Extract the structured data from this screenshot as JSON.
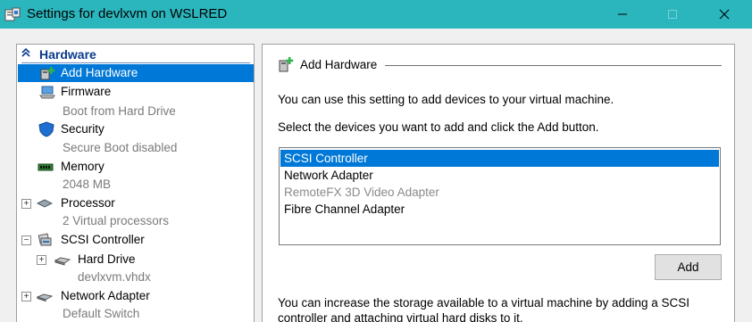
{
  "window": {
    "title": "Settings for devlxvm on WSLRED",
    "minimize_glyph": "—",
    "maximize_glyph": "☐",
    "close_glyph": "✕"
  },
  "tree": {
    "header": "Hardware",
    "header_glyph": "»",
    "items": [
      {
        "label": "Add Hardware",
        "sub": "",
        "icon": "add-hardware-icon",
        "selected": true
      },
      {
        "label": "Firmware",
        "sub": "Boot from Hard Drive",
        "icon": "firmware-icon"
      },
      {
        "label": "Security",
        "sub": "Secure Boot disabled",
        "icon": "shield-icon"
      },
      {
        "label": "Memory",
        "sub": "2048 MB",
        "icon": "memory-icon"
      },
      {
        "label": "Processor",
        "sub": "2 Virtual processors",
        "icon": "processor-icon",
        "expander": "+"
      },
      {
        "label": "SCSI Controller",
        "sub": "",
        "icon": "scsi-controller-icon",
        "expander": "−"
      },
      {
        "label": "Hard Drive",
        "sub": "devlxvm.vhdx",
        "icon": "hard-drive-icon",
        "expander": "+"
      },
      {
        "label": "Network Adapter",
        "sub": "Default Switch",
        "icon": "network-adapter-icon",
        "expander": "+"
      }
    ]
  },
  "main": {
    "section_title": "Add Hardware",
    "intro": "You can use this setting to add devices to your virtual machine.",
    "instruction": "Select the devices you want to add and click the Add button.",
    "devices": [
      {
        "label": "SCSI Controller",
        "state": "selected"
      },
      {
        "label": "Network Adapter",
        "state": "normal"
      },
      {
        "label": "RemoteFX 3D Video Adapter",
        "state": "disabled"
      },
      {
        "label": "Fibre Channel Adapter",
        "state": "normal"
      }
    ],
    "add_button": "Add",
    "footer_line1": "You can increase the storage available to a virtual machine by adding a SCSI",
    "footer_line2": "controller and attaching virtual hard disks to it."
  },
  "colors": {
    "titlebar": "#2bb5bd",
    "selection": "#0078d7",
    "header_text": "#0a3a8c",
    "subtext": "#7a7a7a"
  }
}
